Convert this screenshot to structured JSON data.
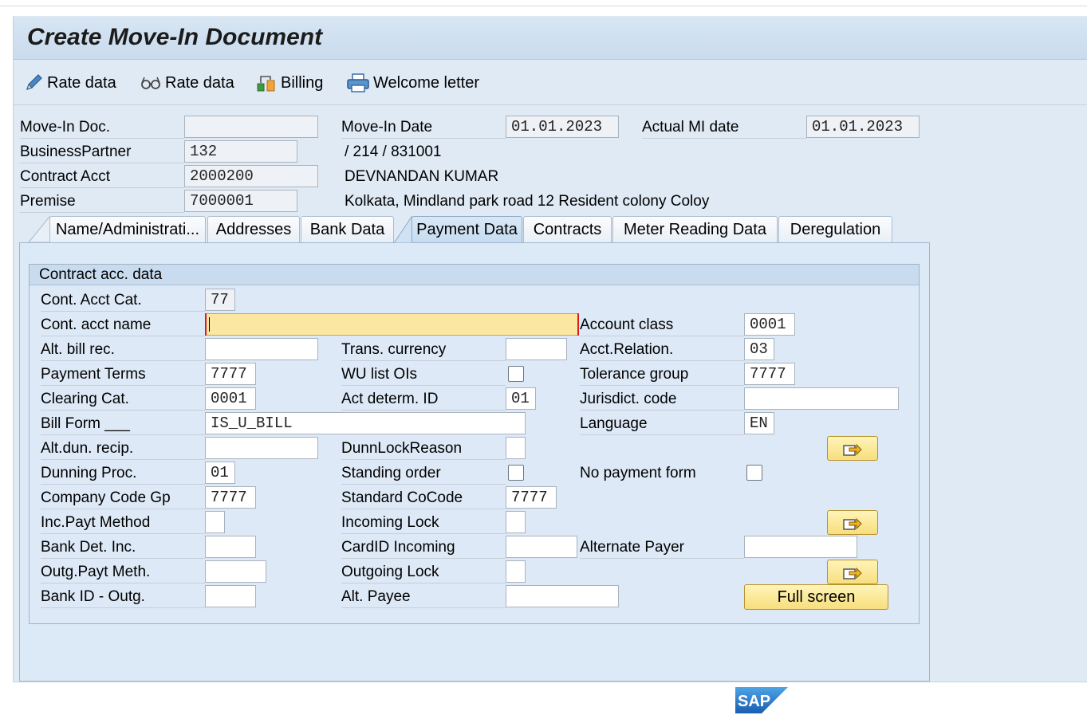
{
  "title": "Create Move-In Document",
  "toolbar": {
    "btn1": "Rate data",
    "btn2": "Rate data",
    "btn3": "Billing",
    "btn4": "Welcome letter"
  },
  "header": {
    "move_in_doc_label": "Move-In Doc.",
    "move_in_doc_value": "",
    "bp_label": "BusinessPartner",
    "bp_value": "132",
    "ca_label": "Contract Acct",
    "ca_value": "2000200",
    "premise_label": "Premise",
    "premise_value": "7000001",
    "move_in_date_label": "Move-In Date",
    "move_in_date_value": "01.01.2023",
    "actual_mi_label": "Actual MI date",
    "actual_mi_value": "01.01.2023",
    "bp_address": "/ 214 / 831001",
    "ca_name": "DEVNANDAN KUMAR",
    "premise_address": "Kolkata, Mindland park road  12  Resident colony  Coloy"
  },
  "tabs": [
    {
      "label": "Name/Administrati...",
      "active": false
    },
    {
      "label": "Addresses",
      "active": false
    },
    {
      "label": "Bank Data",
      "active": false
    },
    {
      "label": "Payment Data",
      "active": true
    },
    {
      "label": "Contracts",
      "active": false
    },
    {
      "label": "Meter Reading Data",
      "active": false
    },
    {
      "label": "Deregulation",
      "active": false
    }
  ],
  "group_title": "Contract acc. data",
  "col1": {
    "cont_acct_cat_label": "Cont. Acct Cat.",
    "cont_acct_cat_value": "77",
    "cont_acct_name_label": "Cont. acct name",
    "cont_acct_name_value": "",
    "alt_bill_rec_label": "Alt. bill rec.",
    "alt_bill_rec_value": "",
    "payment_terms_label": "Payment Terms",
    "payment_terms_value": "7777",
    "clearing_cat_label": "Clearing Cat.",
    "clearing_cat_value": "0001",
    "bill_form_label": "Bill Form ___",
    "bill_form_value": "IS_U_BILL",
    "alt_dun_label": "Alt.dun. recip.",
    "alt_dun_value": "",
    "dunning_proc_label": "Dunning Proc.",
    "dunning_proc_value": "01",
    "company_code_gp_label": "Company Code Gp",
    "company_code_gp_value": "7777",
    "inc_payt_label": "Inc.Payt Method",
    "inc_payt_value": "",
    "bank_det_inc_label": "Bank Det. Inc.",
    "bank_det_inc_value": "",
    "outg_payt_label": "Outg.Payt Meth.",
    "outg_payt_value": "",
    "bank_id_outg_label": "Bank ID - Outg.",
    "bank_id_outg_value": ""
  },
  "col2": {
    "trans_currency_label": "Trans. currency",
    "trans_currency_value": "",
    "wu_list_label": "WU list OIs",
    "act_determ_label": "Act determ. ID",
    "act_determ_value": "01",
    "dunn_lock_label": "DunnLockReason",
    "dunn_lock_value": "",
    "standing_order_label": "Standing order",
    "standard_cocode_label": "Standard CoCode",
    "standard_cocode_value": "7777",
    "incoming_lock_label": "Incoming Lock",
    "incoming_lock_value": "",
    "cardid_incoming_label": "CardID Incoming",
    "cardid_incoming_value": "",
    "outgoing_lock_label": "Outgoing Lock",
    "outgoing_lock_value": "",
    "alt_payee_label": "Alt. Payee",
    "alt_payee_value": ""
  },
  "col3": {
    "account_class_label": "Account class",
    "account_class_value": "0001",
    "acct_relation_label": "Acct.Relation.",
    "acct_relation_value": "03",
    "tolerance_group_label": "Tolerance group",
    "tolerance_group_value": "7777",
    "jurisdict_label": "Jurisdict. code",
    "jurisdict_value": "",
    "language_label": "Language",
    "language_value": "EN",
    "no_payment_form_label": "No payment form",
    "alternate_payer_label": "Alternate Payer",
    "alternate_payer_value": "",
    "full_screen_label": "Full screen"
  },
  "footer": {
    "logo_text": "SAP"
  },
  "colors": {
    "accent": "#f7de7e",
    "frame": "#dfeaf5",
    "active_field": "#fbe7a1",
    "sap_blue": "#1a73c7"
  }
}
